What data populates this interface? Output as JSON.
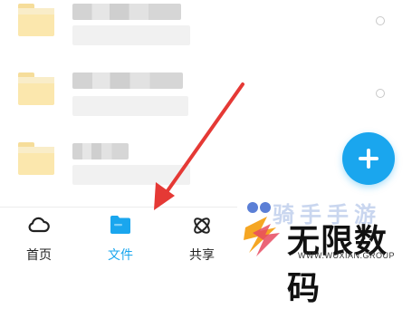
{
  "tabbar": {
    "tabs": [
      {
        "label": "首页",
        "icon": "cloud-icon",
        "active": false
      },
      {
        "label": "文件",
        "icon": "folder-icon",
        "active": true
      },
      {
        "label": "共享",
        "icon": "share-atom-icon",
        "active": false
      }
    ]
  },
  "fab": {
    "icon": "plus-icon"
  },
  "watermark": {
    "top_text": "骑手手游",
    "main_text": "无限数码",
    "url_text": "WWW.WUXIAN.GROUP"
  },
  "colors": {
    "accent": "#1aa6ee",
    "folder": "#fbe7ad",
    "annotation_arrow": "#e53935"
  }
}
